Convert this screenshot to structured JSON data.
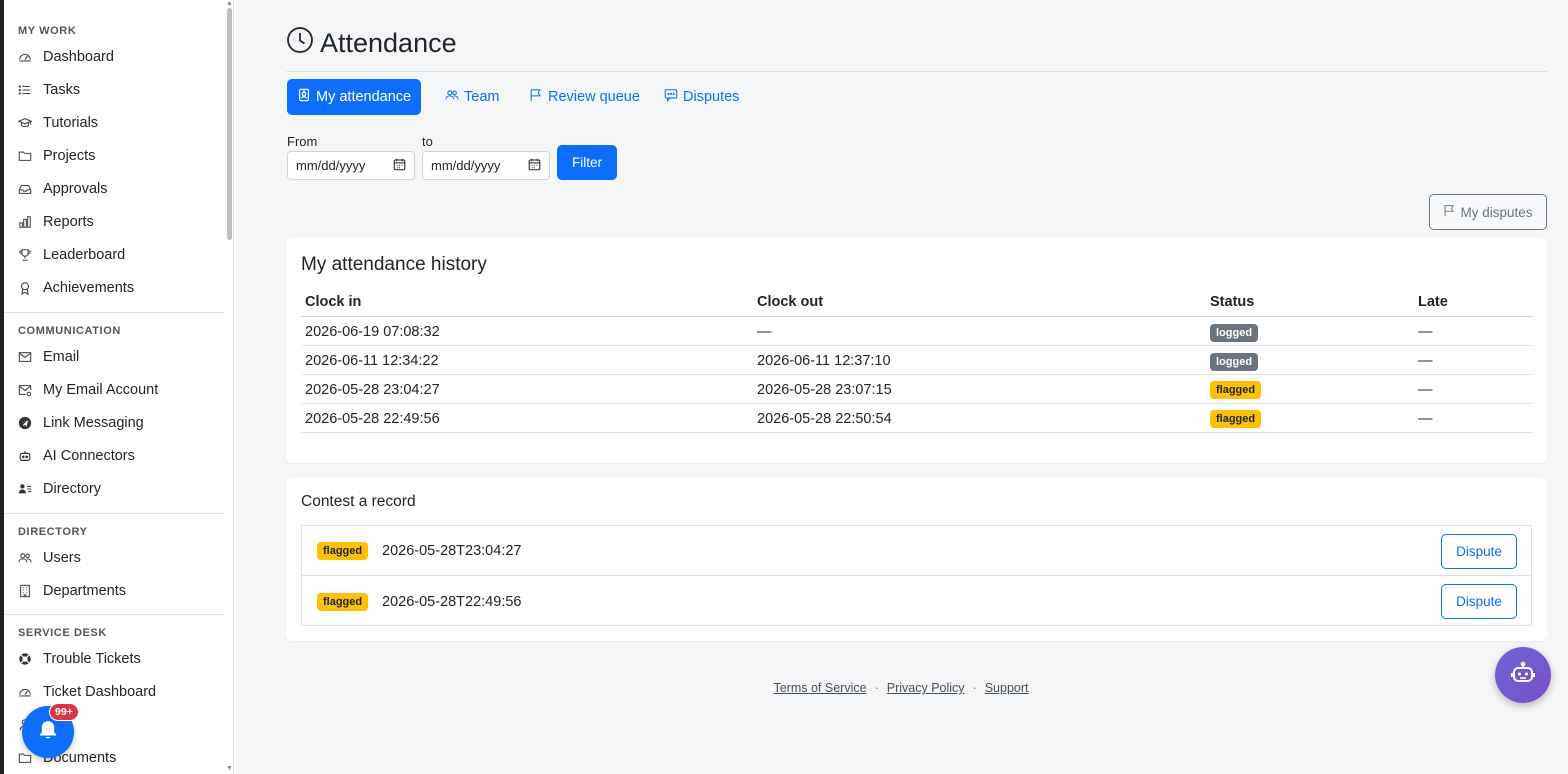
{
  "sidebar": {
    "sections": [
      {
        "label": "MY WORK",
        "items": [
          {
            "label": "Dashboard",
            "icon": "gauge-icon"
          },
          {
            "label": "Tasks",
            "icon": "list-icon"
          },
          {
            "label": "Tutorials",
            "icon": "mortarboard-icon"
          },
          {
            "label": "Projects",
            "icon": "folder-icon"
          },
          {
            "label": "Approvals",
            "icon": "inbox-icon"
          },
          {
            "label": "Reports",
            "icon": "bar-chart-icon"
          },
          {
            "label": "Leaderboard",
            "icon": "trophy-icon"
          },
          {
            "label": "Achievements",
            "icon": "award-icon"
          }
        ]
      },
      {
        "label": "COMMUNICATION",
        "items": [
          {
            "label": "Email",
            "icon": "envelope-icon"
          },
          {
            "label": "My Email Account",
            "icon": "envelope-gear-icon"
          },
          {
            "label": "Link Messaging",
            "icon": "telegram-icon"
          },
          {
            "label": "AI Connectors",
            "icon": "robot-icon"
          },
          {
            "label": "Directory",
            "icon": "person-lines-icon"
          }
        ]
      },
      {
        "label": "DIRECTORY",
        "items": [
          {
            "label": "Users",
            "icon": "people-icon"
          },
          {
            "label": "Departments",
            "icon": "building-icon"
          }
        ]
      },
      {
        "label": "SERVICE DESK",
        "items": [
          {
            "label": "Trouble Tickets",
            "icon": "life-preserver-icon"
          },
          {
            "label": "Ticket Dashboard",
            "icon": "gauge-icon"
          },
          {
            "label": "",
            "icon": "person-icon"
          },
          {
            "label": "Documents",
            "icon": "folder-icon"
          }
        ]
      }
    ],
    "notifications_badge": "99+"
  },
  "page": {
    "title": "Attendance",
    "tabs": [
      {
        "label": "My attendance",
        "active": true
      },
      {
        "label": "Team",
        "active": false
      },
      {
        "label": "Review queue",
        "active": false
      },
      {
        "label": "Disputes",
        "active": false
      }
    ],
    "filter": {
      "from_label": "From",
      "to_label": "to",
      "from_placeholder": "mm/dd/yyyy",
      "to_placeholder": "mm/dd/yyyy",
      "button_label": "Filter"
    },
    "my_disputes_label": "My disputes"
  },
  "history": {
    "title": "My attendance history",
    "columns": [
      "Clock in",
      "Clock out",
      "Status",
      "Late"
    ],
    "rows": [
      {
        "clock_in": "2026-06-19 07:08:32",
        "clock_out": "—",
        "status": "logged",
        "late": "—"
      },
      {
        "clock_in": "2026-06-11 12:34:22",
        "clock_out": "2026-06-11 12:37:10",
        "status": "logged",
        "late": "—"
      },
      {
        "clock_in": "2026-05-28 23:04:27",
        "clock_out": "2026-05-28 23:07:15",
        "status": "flagged",
        "late": "—"
      },
      {
        "clock_in": "2026-05-28 22:49:56",
        "clock_out": "2026-05-28 22:50:54",
        "status": "flagged",
        "late": "—"
      }
    ]
  },
  "contest": {
    "title": "Contest a record",
    "records": [
      {
        "status": "flagged",
        "timestamp": "2026-05-28T23:04:27",
        "button": "Dispute"
      },
      {
        "status": "flagged",
        "timestamp": "2026-05-28T22:49:56",
        "button": "Dispute"
      }
    ]
  },
  "footer": {
    "links": [
      "Terms of Service",
      "Privacy Policy",
      "Support"
    ],
    "separator": "·"
  },
  "colors": {
    "primary": "#0d6efd",
    "logged": "#6c757d",
    "flagged": "#ffc107",
    "notification": "#dc3545",
    "assistant": "#6f63d9"
  }
}
